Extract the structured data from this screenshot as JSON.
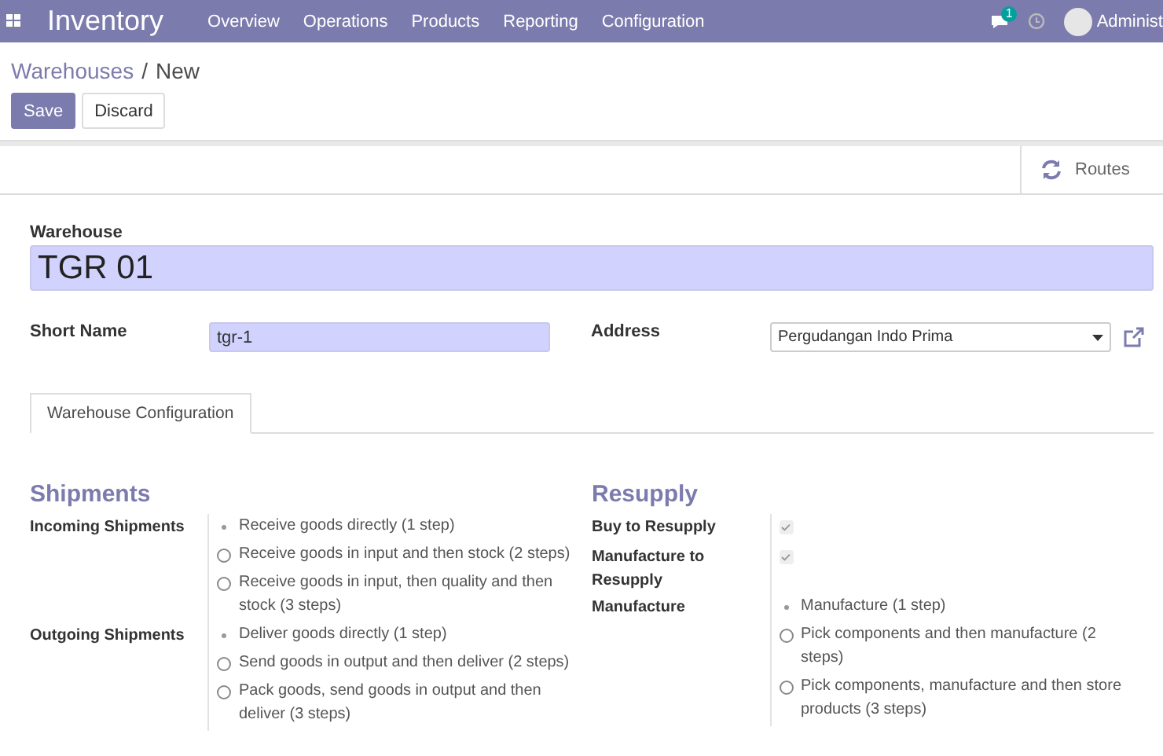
{
  "navbar": {
    "app": "Inventory",
    "menu": [
      "Overview",
      "Operations",
      "Products",
      "Reporting",
      "Configuration"
    ],
    "badge": "1",
    "user": "Administ"
  },
  "breadcrumb": {
    "parent": "Warehouses",
    "separator": "/",
    "current": "New"
  },
  "buttons": [
    {
      "label": "Save",
      "kind": "primary"
    },
    {
      "label": "Discard",
      "kind": "secondary"
    }
  ],
  "smart_buttons": [
    {
      "label": "Routes"
    }
  ],
  "warehouse": {
    "label": "Warehouse",
    "value": "TGR 01"
  },
  "short_name": {
    "label": "Short Name",
    "value": "tgr-1"
  },
  "address": {
    "label": "Address",
    "value": "Pergudangan Indo Prima"
  },
  "tabs": [
    {
      "label": "Warehouse Configuration",
      "selected": true
    }
  ],
  "sections": [
    {
      "title": "Shipments",
      "fields": [
        {
          "label": "Incoming Shipments",
          "kind": "radio",
          "options": [
            {
              "label": "Receive goods directly (1 step)",
              "selected": true
            },
            {
              "label": "Receive goods in input and then stock (2 steps)",
              "selected": false
            },
            {
              "label": "Receive goods in input, then quality and then stock (3 steps)",
              "selected": false
            }
          ]
        },
        {
          "label": "Outgoing Shipments",
          "kind": "radio",
          "options": [
            {
              "label": "Deliver goods directly (1 step)",
              "selected": true
            },
            {
              "label": "Send goods in output and then deliver (2 steps)",
              "selected": false
            },
            {
              "label": "Pack goods, send goods in output and then deliver (3 steps)",
              "selected": false
            }
          ]
        }
      ]
    },
    {
      "title": "Resupply",
      "fields": [
        {
          "label": "Buy to Resupply",
          "kind": "checkbox",
          "checked": true
        },
        {
          "label": "Manufacture to Resupply",
          "kind": "checkbox",
          "checked": true
        },
        {
          "label": "Manufacture",
          "kind": "radio",
          "options": [
            {
              "label": "Manufacture (1 step)",
              "selected": true
            },
            {
              "label": "Pick components and then manufacture (2 steps)",
              "selected": false
            },
            {
              "label": "Pick components, manufacture and then store products (3 steps)",
              "selected": false
            }
          ]
        }
      ]
    }
  ]
}
